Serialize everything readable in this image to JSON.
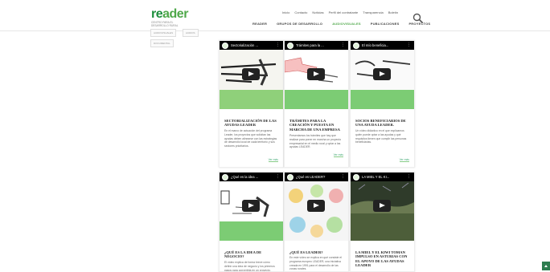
{
  "brand": {
    "logo_word_a": "re",
    "logo_word_b": "ader",
    "logo_tagline": "CENTRO PARA EL DESARROLLO RURAL",
    "accent": "#4fa84a"
  },
  "top_nav": [
    "Inicio",
    "Contacto",
    "Noticias",
    "Perfil del contratante",
    "Transparencia",
    "Boletín"
  ],
  "main_nav": {
    "items": [
      "READER",
      "GRUPOS DE DESARROLLO",
      "AUDIOVISUALES",
      "PUBLICACIONES",
      "PROYECTOS"
    ],
    "active": "AUDIOVISUALES"
  },
  "search_icon": "search-icon",
  "side_tags": [
    "AUDIOVISUALES",
    "AUDIOS",
    "DOCUMENTAL"
  ],
  "cards": [
    {
      "video_title": "Sectorialización ...",
      "title": "SECTORIALIZACIÓN DE LAS AYUDAS LEADER",
      "text": "En el marco de actuación del programa Leader, los proyectos que solicitan las ayudas deben alinearse con las estrategias de desarrollo local de cada territorio y sus sectores prioritarios.",
      "more": "Ver más"
    },
    {
      "video_title": "Trámites para la ...",
      "title": "TRÁMITES PARA LA CREACIÓN Y PUESTA EN MARCHA DE UNA EMPRESA",
      "text": "Presentamos los trámites que hay que realizar para poner en marcha un proyecto empresarial en el medio rural y optar a las ayudas LEADER.",
      "more": "Ver más"
    },
    {
      "video_title": "El mío beneficia...",
      "title": "SOCIOS BENEFICIARIOS DE UNA AYUDA LEADER.",
      "text": "Un vídeo didáctico en el que explicamos quién puede optar a las ayudas y qué requisitos tienen que cumplir las personas beneficiarias.",
      "more": "Ver más"
    },
    {
      "video_title": "¿Qué es la idea ...",
      "title": "¿QUÉ ES LA IDEA DE NEGOCIO?",
      "text": "El vídeo explica de forma breve cómo definir una idea de negocio y los primeros pasos para convertirla en un proyecto.",
      "more": "Ver más"
    },
    {
      "video_title": "¿Qué es LEADER?",
      "title": "¿QUÉ ES LEADER?",
      "text": "En este vídeo se explica en qué consiste el programa europeo LEADER, una iniciativa creada en 1991 para el desarrollo de las zonas rurales.",
      "more": "Ver más"
    },
    {
      "video_title": "LA MIEL Y EL KI...",
      "title": "LA MIEL Y EL KIWI TOMAN IMPULSO EN ASTURIAS CON EL APOYO DE LAS AYUDAS LEADER",
      "text": "",
      "more": ""
    }
  ]
}
